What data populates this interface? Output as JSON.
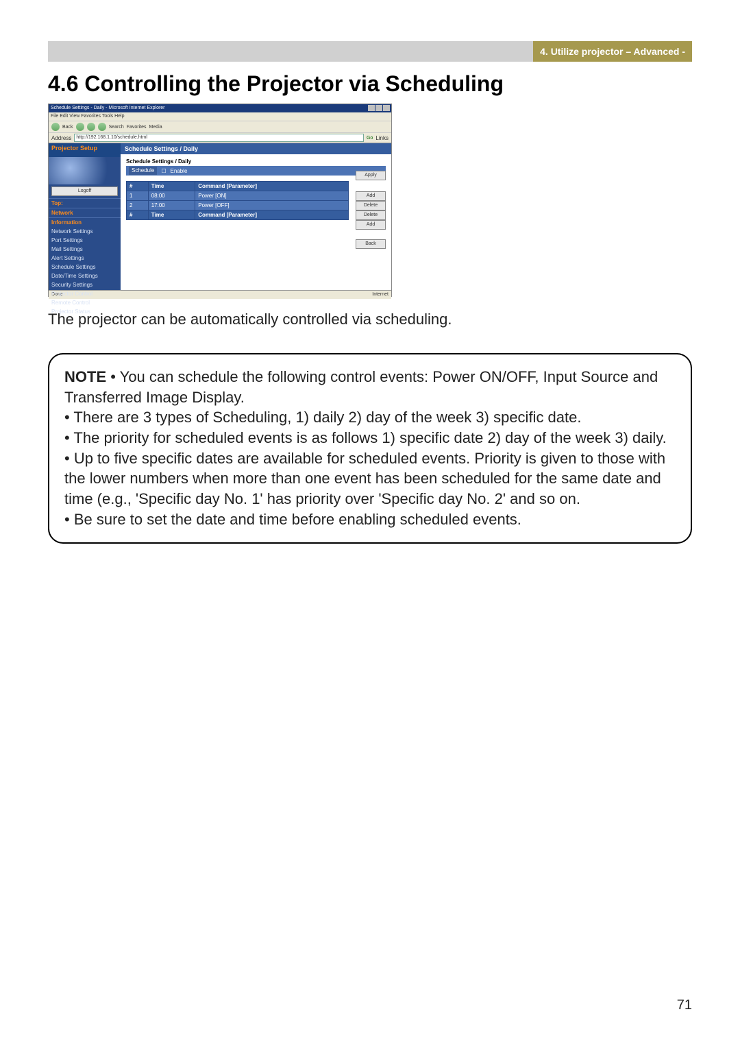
{
  "header": {
    "breadcrumb": "4. Utilize projector – Advanced -"
  },
  "section": {
    "title": "4.6 Controlling the Projector via Scheduling"
  },
  "screenshot": {
    "window_title": "Schedule Settings - Daily - Microsoft Internet Explorer",
    "menubar": "File  Edit  View  Favorites  Tools  Help",
    "toolbar": {
      "back": "Back",
      "search": "Search",
      "favorites": "Favorites",
      "media": "Media"
    },
    "address_label": "Address",
    "address_value": "http://192.168.1.10/schedule.html",
    "go": "Go",
    "links": "Links",
    "left": {
      "projector_setup": "Projector Setup",
      "logoff": "Logoff",
      "top_header": "Top:",
      "network_header": "Network",
      "information_header": "Information",
      "items": [
        "Network Settings",
        "Port Settings",
        "Mail Settings",
        "Alert Settings",
        "Schedule Settings",
        "Date/Time Settings",
        "Security Settings",
        "Projector Control",
        "Remote Control",
        "Projector Status"
      ]
    },
    "main": {
      "titlebar": "Schedule Settings / Daily",
      "subtitle": "Schedule Settings / Daily",
      "schedule_label": "Schedule",
      "enable_label": "Enable",
      "apply": "Apply",
      "table_headers": {
        "num": "#",
        "time": "Time",
        "cmd": "Command [Parameter]"
      },
      "rows": [
        {
          "num": "1",
          "time": "08:00",
          "cmd": "Power [ON]",
          "btn": "Delete"
        },
        {
          "num": "2",
          "time": "17:00",
          "cmd": "Power [OFF]",
          "btn": "Delete"
        }
      ],
      "add_header": {
        "num": "#",
        "time": "Time",
        "cmd": "Command [Parameter]"
      },
      "add_btn": "Add",
      "back_btn": "Back"
    },
    "status_left": "Done",
    "status_right": "Internet"
  },
  "intro": "The projector can be automatically controlled via scheduling.",
  "note": {
    "label": "NOTE",
    "b1": "• You can schedule the following control events: Power ON/OFF, Input Source and Transferred Image Display.",
    "b2": "• There are 3 types of Scheduling, 1) daily 2) day of the week 3) specific date.",
    "b3": "• The priority for scheduled events is as follows 1) specific date 2) day of the week 3) daily.",
    "b4": "• Up to five specific dates are available for scheduled events. Priority is given to those with the lower numbers when more than one event has been scheduled for the same date and time (e.g., 'Specific day No. 1' has priority over 'Specific day No. 2' and so on.",
    "b5": "• Be sure to set the date and time before enabling scheduled events."
  },
  "page_number": "71"
}
